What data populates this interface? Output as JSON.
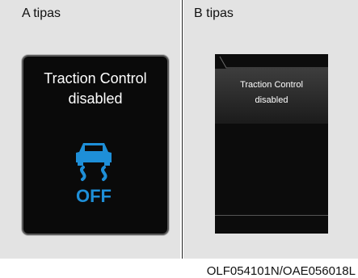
{
  "panels": {
    "a": {
      "label": "A tipas",
      "message_line1": "Traction Control",
      "message_line2": "disabled",
      "icon": "traction-control-off-icon",
      "icon_text": "OFF",
      "icon_color": "#1e8fd8"
    },
    "b": {
      "label": "B tipas",
      "message_line1": "Traction Control",
      "message_line2": "disabled"
    }
  },
  "caption": "OLF054101N/OAE056018L"
}
